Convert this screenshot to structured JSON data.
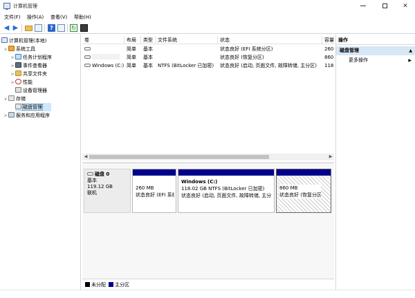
{
  "window": {
    "title": "计算机管理"
  },
  "menu": [
    "文件(F)",
    "操作(A)",
    "查看(V)",
    "帮助(H)"
  ],
  "tree": {
    "root": "计算机管理(本地)",
    "system_tools": "系统工具",
    "task_scheduler": "任务计划程序",
    "event_viewer": "事件查看器",
    "shared_folders": "共享文件夹",
    "performance": "性能",
    "device_manager": "设备管理器",
    "storage": "存储",
    "disk_management": "磁盘管理",
    "services": "服务和应用程序"
  },
  "columns": [
    "卷",
    "布局",
    "类型",
    "文件系统",
    "状态",
    "容量"
  ],
  "volumes": [
    {
      "name": "",
      "layout": "简单",
      "type": "基本",
      "fs": "",
      "status": "状态良好 (EFI 系统分区)",
      "capacity": "260"
    },
    {
      "name": "",
      "layout": "简单",
      "type": "基本",
      "fs": "",
      "status": "状态良好 (恢复分区)",
      "capacity": "860"
    },
    {
      "name": "Windows (C:)",
      "layout": "简单",
      "type": "基本",
      "fs": "NTFS (BitLocker 已加密)",
      "status": "状态良好 (启动, 页面文件, 故障转储, 主分区)",
      "capacity": "118"
    }
  ],
  "disk": {
    "name": "磁盘 0",
    "type": "基本",
    "size": "119.12 GB",
    "state": "联机",
    "partitions": [
      {
        "title": "",
        "size": "260 MB",
        "status": "状态良好 (EFI 系统"
      },
      {
        "title": "Windows (C:)",
        "size": "118.02 GB NTFS (BitLocker 已加密)",
        "status": "状态良好 (启动, 页面文件, 故障转储, 主分"
      },
      {
        "title": "",
        "size": "860 MB",
        "status": "状态良好 (恢复分区)"
      }
    ]
  },
  "legend": {
    "unallocated": "未分配",
    "primary": "主分区"
  },
  "actions": {
    "header": "操作",
    "section": "磁盘管理",
    "more": "更多操作"
  },
  "colors": {
    "primary_partition": "#00008b",
    "unallocated": "#000000",
    "selection": "#cce8ff"
  }
}
